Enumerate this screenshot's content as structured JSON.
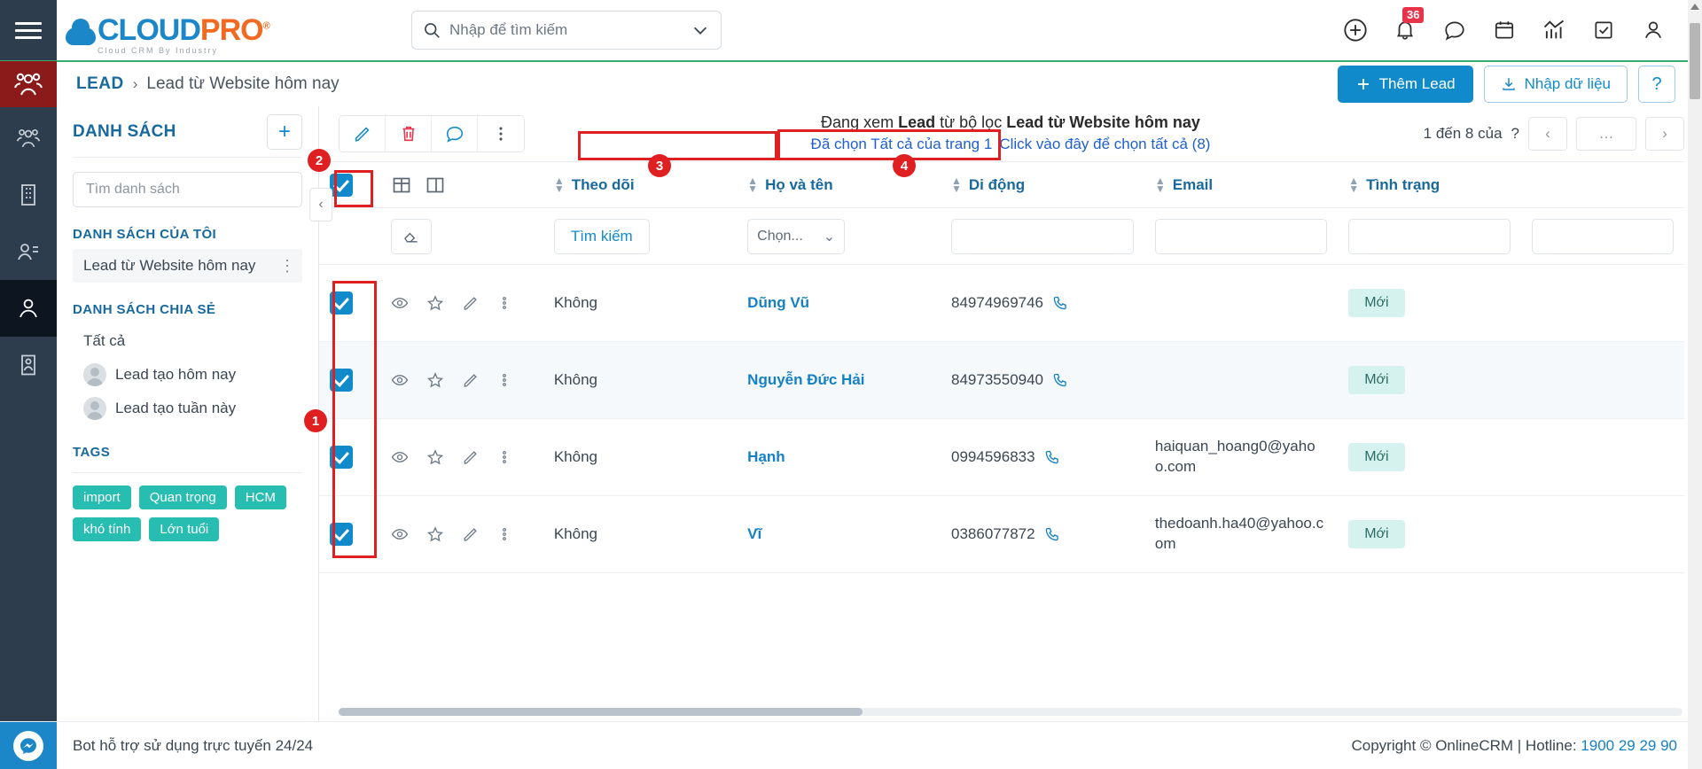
{
  "topbar": {
    "menu_icon": "hamburger-icon",
    "logo_text_1": "CLOUD",
    "logo_text_2": "PRO",
    "logo_reg": "®",
    "logo_tagline": "Cloud CRM By Industry",
    "search_placeholder": "Nhập để tìm kiếm",
    "search_value": "",
    "notification_count": "36",
    "icons": [
      "add-icon",
      "bell-icon",
      "chat-icon",
      "calendar-icon",
      "analytics-icon",
      "task-icon",
      "user-icon"
    ]
  },
  "breadcrumb": {
    "module_icon": "people-icon",
    "root": "LEAD",
    "separator": "›",
    "current": "Lead từ Website hôm nay",
    "add_lead_label": "Thêm Lead",
    "import_label": "Nhập dữ liệu",
    "help_label": "?"
  },
  "rail": {
    "items": [
      "people-icon",
      "building-icon",
      "contacts-icon",
      "lead-icon",
      "document-icon"
    ]
  },
  "sidebar": {
    "title": "DANH SÁCH",
    "add_button": "+",
    "search_placeholder": "Tìm danh sách",
    "search_value": "",
    "group_my": "DANH SÁCH CỦA TÔI",
    "my_items": [
      {
        "label": "Lead từ Website hôm nay",
        "selected": true,
        "kebab": "⋮"
      }
    ],
    "group_shared": "DANH SÁCH CHIA SẺ",
    "shared_items": [
      {
        "label": "Tất cả",
        "avatar": false
      },
      {
        "label": "Lead tạo hôm nay",
        "avatar": true
      },
      {
        "label": "Lead tạo tuần này",
        "avatar": true
      }
    ],
    "group_tags": "TAGS",
    "tags": [
      "import",
      "Quan trọng",
      "HCM",
      "khó tính",
      "Lớn tuổi"
    ],
    "collapse_handle": "‹"
  },
  "toolbar": {
    "buttons": [
      "edit-icon",
      "delete-icon",
      "comment-icon",
      "more-icon"
    ]
  },
  "banner": {
    "prefix": "Đang xem ",
    "bold1": "Lead",
    "mid": " từ bộ lọc ",
    "bold2": "Lead từ Website hôm nay",
    "link_selected_page": "Đã chọn Tất cả của trang 1",
    "link_select_all": "Click vào đây để chọn tất cả (8)"
  },
  "pager": {
    "range_text": "1 đến 8 của",
    "total": "?",
    "prev": "‹",
    "more": "…",
    "next": "›"
  },
  "table": {
    "view_icons": [
      "grid-view-icon",
      "split-view-icon"
    ],
    "columns": [
      {
        "key": "checkbox",
        "label": "",
        "sortable": false
      },
      {
        "key": "actions",
        "label": "",
        "sortable": false
      },
      {
        "key": "follow",
        "label": "Theo dõi",
        "sortable": true
      },
      {
        "key": "name",
        "label": "Họ và tên",
        "sortable": true
      },
      {
        "key": "mobile",
        "label": "Di động",
        "sortable": true
      },
      {
        "key": "email",
        "label": "Email",
        "sortable": true
      },
      {
        "key": "status",
        "label": "Tình trạng",
        "sortable": true
      }
    ],
    "filter_row": {
      "clear_icon": "eraser-icon",
      "search_label": "Tìm kiếm",
      "select_placeholder": "Chọn...",
      "name_value": "",
      "mobile_value": "",
      "email_value": "",
      "status_value": ""
    },
    "rows": [
      {
        "checked": true,
        "row_icons": [
          "eye-icon",
          "star-icon",
          "pencil-icon",
          "kebab-icon"
        ],
        "follow": "Không",
        "name": "Dũng Vũ",
        "mobile": "84974969746",
        "email": "",
        "status": "Mới"
      },
      {
        "checked": true,
        "row_icons": [
          "eye-icon",
          "star-icon",
          "pencil-icon",
          "kebab-icon"
        ],
        "follow": "Không",
        "name": "Nguyễn Đức Hải",
        "mobile": "84973550940",
        "email": "",
        "status": "Mới"
      },
      {
        "checked": true,
        "row_icons": [
          "eye-icon",
          "star-icon",
          "pencil-icon",
          "kebab-icon"
        ],
        "follow": "Không",
        "name": "Hạnh",
        "mobile": "0994596833",
        "email": "haiquan_hoang0@yahoo.com",
        "status": "Mới"
      },
      {
        "checked": true,
        "row_icons": [
          "eye-icon",
          "star-icon",
          "pencil-icon",
          "kebab-icon"
        ],
        "follow": "Không",
        "name": "Vĩ",
        "mobile": "0386077872",
        "email": "thedoanh.ha40@yahoo.com",
        "status": "Mới"
      }
    ]
  },
  "annotations": [
    {
      "num": "1"
    },
    {
      "num": "2"
    },
    {
      "num": "3"
    },
    {
      "num": "4"
    }
  ],
  "footer": {
    "bot_text": "Bot hỗ trợ sử dụng trực tuyến 24/24",
    "copyright": "Copyright © OnlineCRM | Hotline: ",
    "hotline": "1900 29 29 90"
  },
  "colors": {
    "accent": "#118acb",
    "brand_orange": "#f26a21",
    "rail_bg": "#2e3d4e",
    "module_red": "#8b1a1a",
    "badge_red": "#e8334a",
    "tag_teal": "#27bdb0",
    "status_pill_bg": "#d6f2ef",
    "annotation_red": "#e02020",
    "green_rule": "#3aab6e"
  }
}
